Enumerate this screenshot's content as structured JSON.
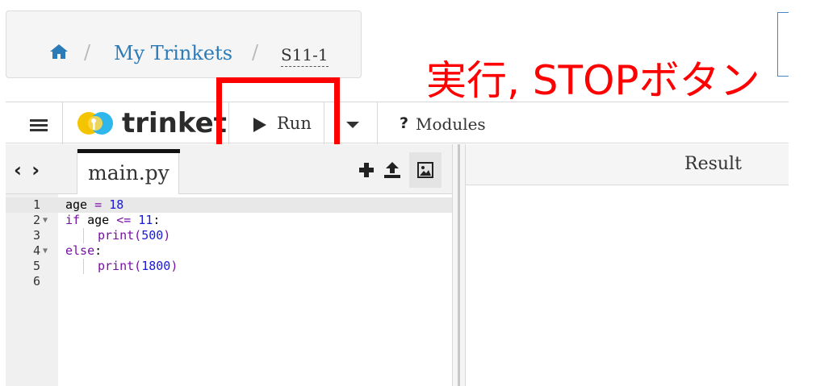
{
  "breadcrumb": {
    "home_icon": "home-icon",
    "separator": "/",
    "link": "My Trinkets",
    "current": "S11-1"
  },
  "annotation": {
    "text": "実行, STOPボタン",
    "color": "#ff0000"
  },
  "toolbar": {
    "menu_icon": "hamburger-menu-icon",
    "logo_text": "trinket",
    "run_label": "Run",
    "modules_prefix": "?",
    "modules_label": "Modules"
  },
  "editor": {
    "nav_arrows": "‹ ›",
    "file_tab": "main.py",
    "lines": [
      {
        "n": "1",
        "fold": false
      },
      {
        "n": "2",
        "fold": true
      },
      {
        "n": "3",
        "fold": false
      },
      {
        "n": "4",
        "fold": true
      },
      {
        "n": "5",
        "fold": false
      },
      {
        "n": "6",
        "fold": false
      }
    ],
    "code": {
      "l1_var": "age",
      "l1_op": " = ",
      "l1_num": "18",
      "l2_kw": "if",
      "l2_var": " age ",
      "l2_op": "<=",
      "l2_num": " 11",
      "l2_colon": ":",
      "l3_fn": "print(",
      "l3_num": "500",
      "l3_close": ")",
      "l4_kw": "else",
      "l4_colon": ":",
      "l5_fn": "print(",
      "l5_num": "1800",
      "l5_close": ")"
    }
  },
  "result": {
    "label": "Result"
  },
  "colors": {
    "link": "#2b7bb9",
    "highlight": "#ff0000",
    "keyword": "#7a0fa8",
    "number": "#1a1ad6"
  }
}
